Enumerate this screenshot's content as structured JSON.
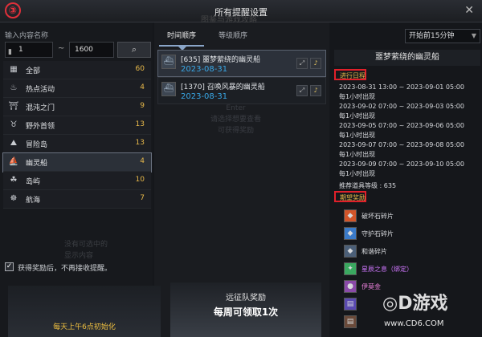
{
  "window": {
    "title": "所有提醒设置",
    "ghost": "图鉴与游戏攻略",
    "close": "✕",
    "step_marker": "③"
  },
  "left": {
    "input_label": "输入内容名称",
    "range_from": "1",
    "range_to": "1600",
    "range_sep": "~",
    "categories": [
      {
        "name": "全部",
        "count": "60",
        "icon": "grid-icon",
        "glyph": "▦"
      },
      {
        "name": "热点活动",
        "count": "4",
        "icon": "flame-icon",
        "glyph": "♨"
      },
      {
        "name": "混沌之门",
        "count": "9",
        "icon": "gate-icon",
        "glyph": "⛩"
      },
      {
        "name": "野外首领",
        "count": "13",
        "icon": "horns-icon",
        "glyph": "♉"
      },
      {
        "name": "冒险岛",
        "count": "13",
        "icon": "island-icon",
        "glyph": "⛰"
      },
      {
        "name": "幽灵船",
        "count": "4",
        "icon": "ship-icon",
        "glyph": "⛵"
      },
      {
        "name": "岛屿",
        "count": "10",
        "icon": "palm-icon",
        "glyph": "☘"
      },
      {
        "name": "航海",
        "count": "7",
        "icon": "wheel-icon",
        "glyph": "☸"
      }
    ],
    "faded_lines": [
      "没有可选中的",
      "显示内容"
    ],
    "checkbox_label": "获得奖励后，不再接收提醒。"
  },
  "middle": {
    "tabs": [
      "时间顺序",
      "等级顺序"
    ],
    "entries": [
      {
        "name": "[635] 噩梦萦绕的幽灵船",
        "date": "2023-08-31"
      },
      {
        "name": "[1370] 召唤风暴的幽灵船",
        "date": "2023-08-31"
      }
    ],
    "ghost_lines": [
      "Enter",
      "请选择想要查看",
      "可获得奖励"
    ]
  },
  "right": {
    "select_value": "开始前15分钟",
    "detail_title": "噩梦萦绕的幽灵船",
    "schedule_label": "进行日程",
    "schedule": [
      "2023-08-31 13:00 ~ 2023-09-01 05:00",
      "每1小时出现",
      "2023-09-02 07:00 ~ 2023-09-03 05:00",
      "每1小时出现",
      "2023-09-05 07:00 ~ 2023-09-06 05:00",
      "每1小时出现",
      "2023-09-07 07:00 ~ 2023-09-08 05:00",
      "每1小时出现",
      "2023-09-09 07:00 ~ 2023-09-10 05:00",
      "每1小时出现"
    ],
    "level_text": "推荐道具等级 : 635",
    "reward_label": "期望奖励",
    "rewards": [
      {
        "name": "破坏石碎片",
        "color": "#d2552a"
      },
      {
        "name": "守护石碎片",
        "color": "#3a7ac8"
      },
      {
        "name": "和谐碎片",
        "color": "#4b5f78"
      },
      {
        "name": "星辰之息（绑定）",
        "color": "#3aa860"
      },
      {
        "name": "伊莫金",
        "color": "#8a4aa8"
      },
      {
        "name": "",
        "color": "#5a4ab0"
      },
      {
        "name": "",
        "color": "#6a4a3a"
      }
    ]
  },
  "bottom": {
    "left_text": "每天上午6点初始化",
    "mid_title": "远征队奖励",
    "mid_sub": "每周可领取1次"
  },
  "watermark": {
    "brand": "◎D游戏",
    "url": "www.CD6.COM"
  }
}
